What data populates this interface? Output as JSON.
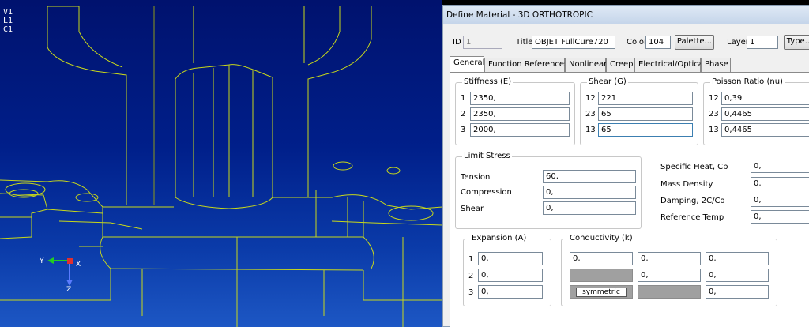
{
  "viewport": {
    "labels": [
      "V1",
      "L1",
      "C1"
    ],
    "axes": {
      "x": "X",
      "y": "Y",
      "z": "Z"
    }
  },
  "dialog": {
    "title": "Define Material - 3D ORTHOTROPIC",
    "id_label": "ID",
    "id_value": "1",
    "title_label": "Title",
    "title_value": "OBJET FullCure720",
    "color_label": "Color",
    "color_value": "104",
    "palette_button": "Palette...",
    "layer_label": "Layer",
    "layer_value": "1",
    "type_button": "Type...",
    "tabs": [
      "General",
      "Function References",
      "Nonlinear",
      "Creep",
      "Electrical/Optical",
      "Phase"
    ],
    "stiffness": {
      "title": "Stiffness (E)",
      "rows": [
        {
          "idx": "1",
          "value": "2350,"
        },
        {
          "idx": "2",
          "value": "2350,"
        },
        {
          "idx": "3",
          "value": "2000,"
        }
      ]
    },
    "shear_modulus": {
      "title": "Shear (G)",
      "rows": [
        {
          "idx": "12",
          "value": "221"
        },
        {
          "idx": "23",
          "value": "65"
        },
        {
          "idx": "13",
          "value": "65"
        }
      ]
    },
    "poisson": {
      "title": "Poisson Ratio (nu)",
      "rows": [
        {
          "idx": "12",
          "value": "0,39"
        },
        {
          "idx": "23",
          "value": "0,4465"
        },
        {
          "idx": "13",
          "value": "0,4465"
        }
      ]
    },
    "limit_stress": {
      "title": "Limit Stress",
      "rows": [
        {
          "label": "Tension",
          "value": "60,"
        },
        {
          "label": "Compression",
          "value": "0,"
        },
        {
          "label": "Shear",
          "value": "0,"
        }
      ]
    },
    "thermal": [
      {
        "label": "Specific Heat, Cp",
        "value": "0,"
      },
      {
        "label": "Mass Density",
        "value": "0,"
      },
      {
        "label": "Damping, 2C/Co",
        "value": "0,"
      },
      {
        "label": "Reference Temp",
        "value": "0,"
      }
    ],
    "expansion": {
      "title": "Expansion (A)",
      "rows": [
        {
          "idx": "1",
          "value": "0,"
        },
        {
          "idx": "2",
          "value": "0,"
        },
        {
          "idx": "3",
          "value": "0,"
        }
      ]
    },
    "conductivity": {
      "title": "Conductivity (k)",
      "row1": [
        "0,",
        "0,",
        "0,"
      ],
      "row2": [
        "0,",
        "0,"
      ],
      "row3": [
        "0,"
      ],
      "symmetric_label": "symmetric"
    }
  }
}
